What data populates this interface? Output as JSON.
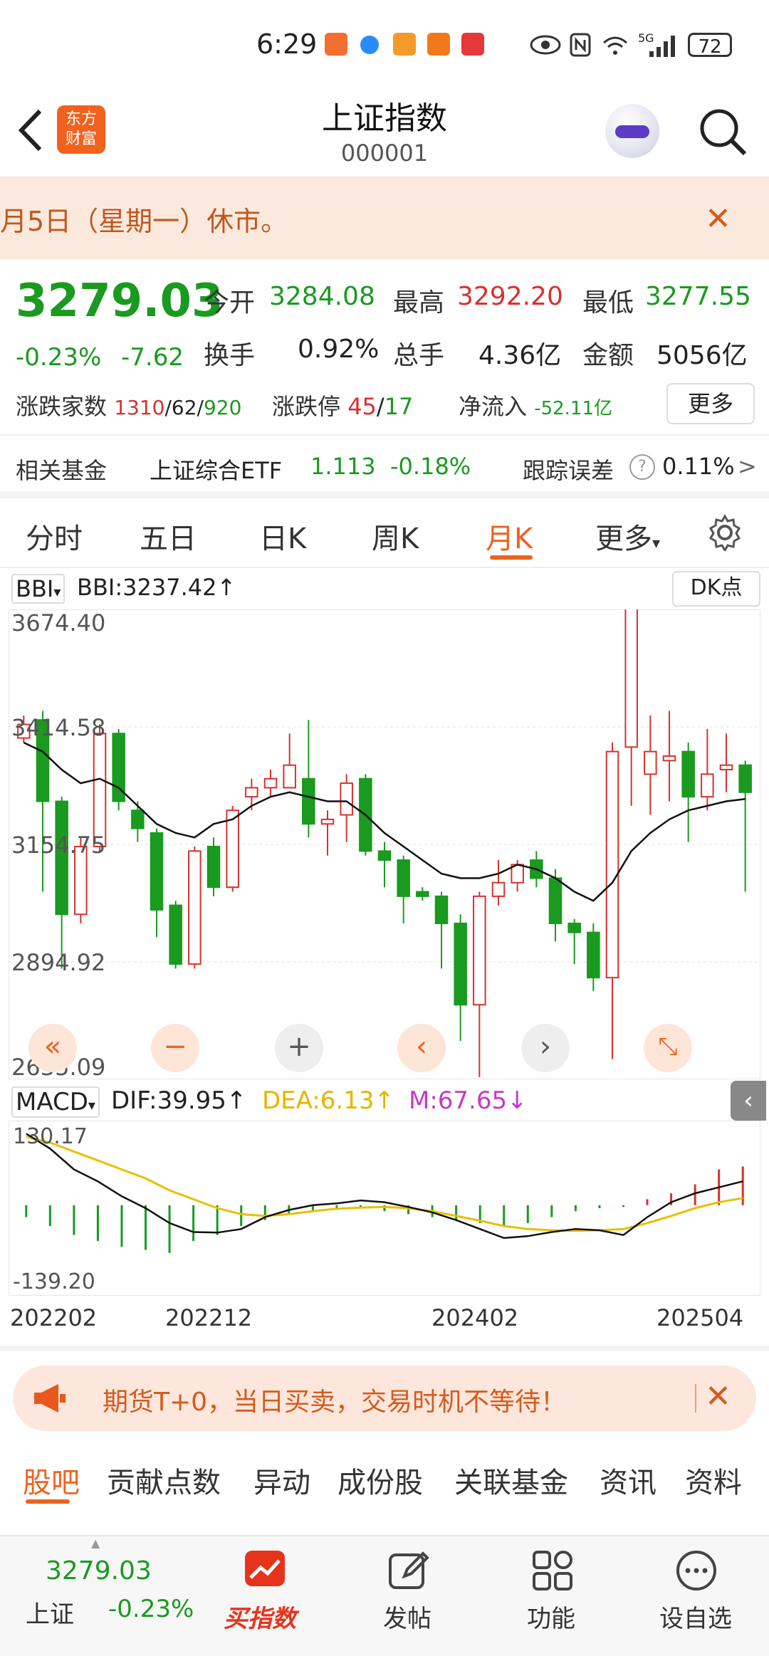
{
  "status_bar": {
    "time": "6:29",
    "signal_label": "5G",
    "battery": "72"
  },
  "header": {
    "logo_text_line1": "东方",
    "logo_text_line2": "财富",
    "title": "上证指数",
    "code": "000001"
  },
  "notice": {
    "text": "月5日（星期一）休市。",
    "close": "✕"
  },
  "quote": {
    "price": "3279.03",
    "change_pct": "-0.23%",
    "change_abs": "-7.62",
    "open_label": "今开",
    "open": "3284.08",
    "high_label": "最高",
    "high": "3292.20",
    "low_label": "最低",
    "low": "3277.55",
    "turnover_label": "换手",
    "turnover": "0.92%",
    "volume_label": "总手",
    "volume": "4.36亿",
    "amount_label": "金额",
    "amount": "5056亿",
    "breadth_label": "涨跌家数",
    "breadth_up": "1310",
    "breadth_sep1": "/",
    "breadth_flat": "62",
    "breadth_sep2": "/",
    "breadth_down": "920",
    "limit_label": "涨跌停",
    "limit_up": "45",
    "limit_sep": "/",
    "limit_down": "17",
    "netflow_label": "净流入",
    "netflow": "-52.11亿",
    "more_button": "更多"
  },
  "fund": {
    "label": "相关基金",
    "name": "上证综合ETF",
    "price": "1.113",
    "change": "-0.18%",
    "tracking_label": "跟踪误差",
    "tracking_help": "?",
    "tracking_value": "0.11%",
    "arrow": ">"
  },
  "tabs": [
    {
      "label": "分时"
    },
    {
      "label": "五日"
    },
    {
      "label": "日K"
    },
    {
      "label": "周K"
    },
    {
      "label": "月K"
    },
    {
      "label": "更多"
    }
  ],
  "indicator": {
    "name": "BBI",
    "value_text": "BBI:3237.42↑",
    "dk_button": "DK点"
  },
  "macd": {
    "name": "MACD",
    "dif": "DIF:39.95↑",
    "dea": "DEA:6.13↑",
    "m": "M:67.65↓",
    "y_top": "130.17",
    "y_bottom": "-139.20"
  },
  "chart_data": {
    "type": "candlestick",
    "y_ticks": [
      "3674.40",
      "3414.58",
      "3154.75",
      "2894.92",
      "2635.09"
    ],
    "ylim": [
      2635.09,
      3674.4
    ],
    "x_ticks": [
      "202202",
      "202212",
      "202402",
      "202504"
    ],
    "candles": [
      {
        "o": 3390,
        "c": 3420,
        "h": 3440,
        "l": 3380
      },
      {
        "o": 3430,
        "c": 3250,
        "h": 3450,
        "l": 3050
      },
      {
        "o": 3250,
        "c": 3000,
        "h": 3260,
        "l": 2880
      },
      {
        "o": 3000,
        "c": 3150,
        "h": 3170,
        "l": 2980
      },
      {
        "o": 3150,
        "c": 3400,
        "h": 3420,
        "l": 3140
      },
      {
        "o": 3400,
        "c": 3250,
        "h": 3410,
        "l": 3230
      },
      {
        "o": 3230,
        "c": 3190,
        "h": 3250,
        "l": 3160
      },
      {
        "o": 3180,
        "c": 3010,
        "h": 3190,
        "l": 2950
      },
      {
        "o": 3020,
        "c": 2890,
        "h": 3030,
        "l": 2880
      },
      {
        "o": 2890,
        "c": 3140,
        "h": 3150,
        "l": 2880
      },
      {
        "o": 3150,
        "c": 3060,
        "h": 3170,
        "l": 3040
      },
      {
        "o": 3060,
        "c": 3230,
        "h": 3240,
        "l": 3050
      },
      {
        "o": 3260,
        "c": 3280,
        "h": 3300,
        "l": 3230
      },
      {
        "o": 3280,
        "c": 3300,
        "h": 3320,
        "l": 3260
      },
      {
        "o": 3280,
        "c": 3330,
        "h": 3400,
        "l": 3280
      },
      {
        "o": 3300,
        "c": 3200,
        "h": 3430,
        "l": 3170
      },
      {
        "o": 3200,
        "c": 3210,
        "h": 3230,
        "l": 3130
      },
      {
        "o": 3220,
        "c": 3290,
        "h": 3310,
        "l": 3160
      },
      {
        "o": 3300,
        "c": 3140,
        "h": 3310,
        "l": 3130
      },
      {
        "o": 3140,
        "c": 3120,
        "h": 3160,
        "l": 3060
      },
      {
        "o": 3120,
        "c": 3040,
        "h": 3130,
        "l": 2980
      },
      {
        "o": 3050,
        "c": 3040,
        "h": 3060,
        "l": 3030
      },
      {
        "o": 3040,
        "c": 2980,
        "h": 3050,
        "l": 2880
      },
      {
        "o": 2980,
        "c": 2800,
        "h": 3000,
        "l": 2720
      },
      {
        "o": 2800,
        "c": 3040,
        "h": 3050,
        "l": 2640
      },
      {
        "o": 3040,
        "c": 3070,
        "h": 3120,
        "l": 3020
      },
      {
        "o": 3070,
        "c": 3110,
        "h": 3120,
        "l": 3050
      },
      {
        "o": 3120,
        "c": 3080,
        "h": 3140,
        "l": 3060
      },
      {
        "o": 3080,
        "c": 2980,
        "h": 3100,
        "l": 2940
      },
      {
        "o": 2980,
        "c": 2960,
        "h": 2990,
        "l": 2890
      },
      {
        "o": 2960,
        "c": 2860,
        "h": 2980,
        "l": 2830
      },
      {
        "o": 2860,
        "c": 3360,
        "h": 3380,
        "l": 2680
      },
      {
        "o": 3370,
        "c": 3680,
        "h": 3680,
        "l": 3240
      },
      {
        "o": 3310,
        "c": 3360,
        "h": 3440,
        "l": 3220
      },
      {
        "o": 3340,
        "c": 3350,
        "h": 3450,
        "l": 3250
      },
      {
        "o": 3360,
        "c": 3260,
        "h": 3380,
        "l": 3160
      },
      {
        "o": 3260,
        "c": 3310,
        "h": 3410,
        "l": 3230
      },
      {
        "o": 3320,
        "c": 3330,
        "h": 3400,
        "l": 3270
      },
      {
        "o": 3330,
        "c": 3270,
        "h": 3340,
        "l": 3050
      }
    ],
    "bbi_line": [
      3380,
      3360,
      3320,
      3290,
      3300,
      3280,
      3240,
      3200,
      3180,
      3170,
      3200,
      3210,
      3240,
      3260,
      3270,
      3260,
      3250,
      3250,
      3220,
      3180,
      3150,
      3120,
      3090,
      3080,
      3080,
      3090,
      3110,
      3100,
      3080,
      3050,
      3030,
      3070,
      3140,
      3180,
      3210,
      3230,
      3240,
      3250,
      3255
    ],
    "macd_dif": [
      120,
      95,
      60,
      40,
      15,
      -5,
      -30,
      -45,
      -46,
      -40,
      -20,
      -8,
      0,
      3,
      8,
      5,
      -3,
      -12,
      -25,
      -40,
      -55,
      -52,
      -45,
      -40,
      -42,
      -50,
      -20,
      5,
      20,
      30,
      40
    ],
    "macd_dea": [
      115,
      105,
      90,
      75,
      60,
      45,
      25,
      10,
      -5,
      -15,
      -18,
      -15,
      -10,
      -6,
      -4,
      -3,
      -5,
      -10,
      -18,
      -26,
      -35,
      -40,
      -42,
      -43,
      -42,
      -40,
      -30,
      -18,
      -5,
      5,
      12
    ],
    "macd_hist": [
      -20,
      -35,
      -50,
      -60,
      -70,
      -75,
      -80,
      -60,
      -50,
      -35,
      -25,
      -15,
      -10,
      -8,
      -5,
      -10,
      -15,
      -20,
      -25,
      -30,
      -35,
      -30,
      -20,
      -10,
      -5,
      -3,
      10,
      20,
      35,
      60,
      65
    ]
  },
  "promo": {
    "text": "期货T+0，当日买卖，交易时机不等待！",
    "close": "✕"
  },
  "sub_tabs": [
    {
      "label": "股吧"
    },
    {
      "label": "贡献点数"
    },
    {
      "label": "异动"
    },
    {
      "label": "成份股"
    },
    {
      "label": "关联基金"
    },
    {
      "label": "资讯"
    },
    {
      "label": "资料"
    }
  ],
  "bottom_nav": {
    "index_price": "3279.03",
    "index_name": "上证",
    "index_change": "-0.23%",
    "buy": "买指数",
    "post": "发帖",
    "tools": "功能",
    "watch": "设自选"
  },
  "colors": {
    "up": "#d6322f",
    "down": "#1a9a1f",
    "accent": "#f0621e"
  }
}
